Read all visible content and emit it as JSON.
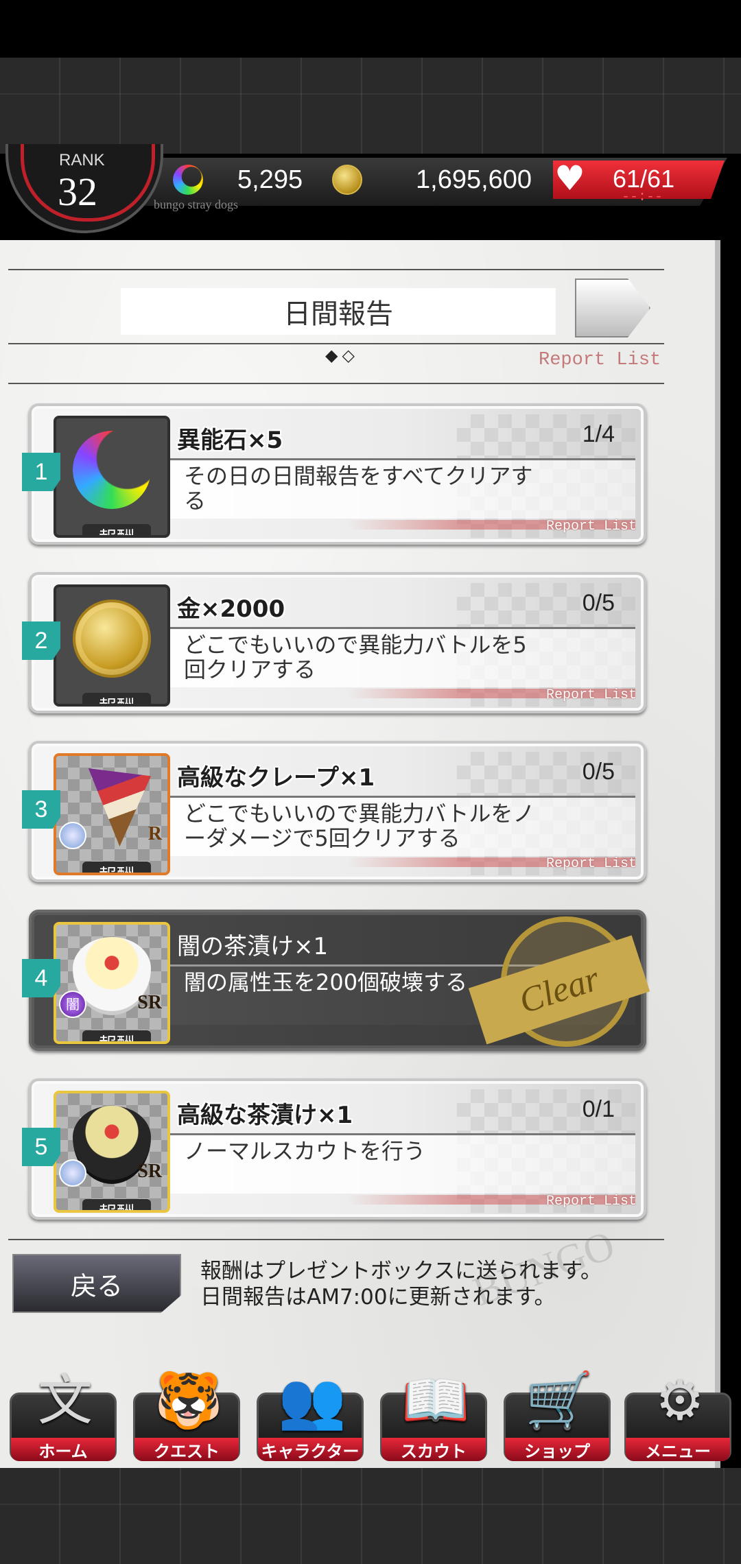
{
  "status": {
    "rank_label": "RANK",
    "rank_value": "32",
    "gems": "5,295",
    "money": "1,695,600",
    "hp": "61/61",
    "hp_timer": "--:--",
    "game_subtitle": "bungo stray dogs"
  },
  "header": {
    "title": "日間報告",
    "pager": "◆◇",
    "report_list": "Report List"
  },
  "missions": [
    {
      "number": "1",
      "reward": "異能石×5",
      "progress": "1/4",
      "description": "その日の日間報告をすべてクリアする",
      "reward_label": "報酬",
      "footer": "Report List",
      "icon": "rainbow-moon-stone-icon"
    },
    {
      "number": "2",
      "reward": "金×2000",
      "progress": "0/5",
      "description": "どこでもいいので異能力バトルを5回クリアする",
      "reward_label": "報酬",
      "footer": "Report List",
      "icon": "gold-coin-icon"
    },
    {
      "number": "3",
      "reward": "高級なクレープ×1",
      "progress": "0/5",
      "description": "どこでもいいので異能力バトルをノーダメージで5回クリアする",
      "reward_label": "報酬",
      "footer": "Report List",
      "icon": "crepe-icon",
      "rarity": "R"
    },
    {
      "number": "4",
      "reward": "闇の茶漬け×1",
      "progress": "",
      "description": "闇の属性玉を200個破壊する",
      "reward_label": "報酬",
      "footer": "",
      "icon": "ochazuke-bowl-icon",
      "rarity": "SR",
      "attribute": "闇",
      "stamp": "Clear",
      "cleared": true
    },
    {
      "number": "5",
      "reward": "高級な茶漬け×1",
      "progress": "0/1",
      "description": "ノーマルスカウトを行う",
      "reward_label": "報酬",
      "footer": "Report List",
      "icon": "dark-ochazuke-bowl-icon",
      "rarity": "SR"
    }
  ],
  "footer": {
    "back_label": "戻る",
    "notice_line1": "報酬はプレゼントボックスに送られます。",
    "notice_line2": "日間報告はAM7:00に更新されます。"
  },
  "nav": [
    {
      "label": "ホーム",
      "glyph": "文",
      "icon": "home-bungo-icon"
    },
    {
      "label": "クエスト",
      "glyph": "🐯",
      "icon": "quest-tiger-icon"
    },
    {
      "label": "キャラクター",
      "glyph": "👥",
      "icon": "character-icon"
    },
    {
      "label": "スカウト",
      "glyph": "📖",
      "icon": "scout-book-icon"
    },
    {
      "label": "ショップ",
      "glyph": "🛒",
      "icon": "shop-cart-icon"
    },
    {
      "label": "メニュー",
      "glyph": "⚙",
      "icon": "menu-gear-icon"
    }
  ],
  "colors": {
    "accent_teal": "#27a9a0",
    "hp_red": "#e0283a",
    "stamp_gold": "#c9a94e"
  }
}
